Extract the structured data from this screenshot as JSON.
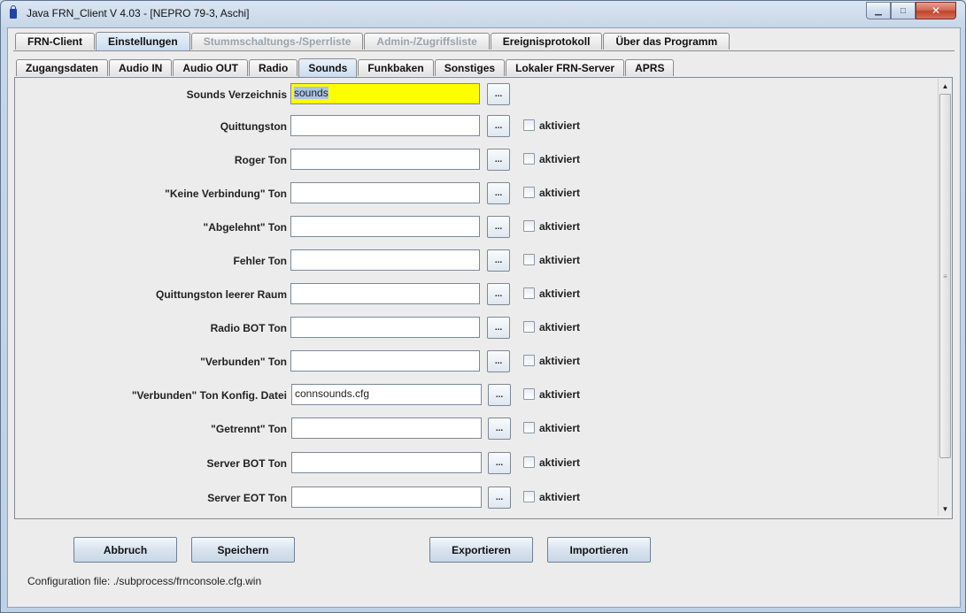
{
  "window": {
    "title": "Java FRN_Client V 4.03 - [NEPRO 79-3, Aschi]"
  },
  "main_tabs": [
    {
      "label": "FRN-Client",
      "state": "normal"
    },
    {
      "label": "Einstellungen",
      "state": "selected"
    },
    {
      "label": "Stummschaltungs-/Sperrliste",
      "state": "disabled"
    },
    {
      "label": "Admin-/Zugriffsliste",
      "state": "disabled"
    },
    {
      "label": "Ereignisprotokoll",
      "state": "normal"
    },
    {
      "label": "Über das Programm",
      "state": "normal"
    }
  ],
  "sub_tabs": [
    {
      "label": "Zugangsdaten",
      "state": "normal"
    },
    {
      "label": "Audio IN",
      "state": "normal"
    },
    {
      "label": "Audio OUT",
      "state": "normal"
    },
    {
      "label": "Radio",
      "state": "normal"
    },
    {
      "label": "Sounds",
      "state": "selected"
    },
    {
      "label": "Funkbaken",
      "state": "normal"
    },
    {
      "label": "Sonstiges",
      "state": "normal"
    },
    {
      "label": "Lokaler FRN-Server",
      "state": "normal"
    },
    {
      "label": "APRS",
      "state": "normal"
    }
  ],
  "browse_label": "...",
  "checkbox_label": "aktiviert",
  "rows": [
    {
      "label": "Sounds Verzeichnis",
      "value": "sounds",
      "checkbox": false,
      "highlight": true
    },
    {
      "label": "Quittungston",
      "value": "",
      "checkbox": true,
      "checked": false
    },
    {
      "label": "Roger Ton",
      "value": "",
      "checkbox": true,
      "checked": false
    },
    {
      "label": "\"Keine Verbindung\" Ton",
      "value": "",
      "checkbox": true,
      "checked": false
    },
    {
      "label": "\"Abgelehnt\" Ton",
      "value": "",
      "checkbox": true,
      "checked": false
    },
    {
      "label": "Fehler Ton",
      "value": "",
      "checkbox": true,
      "checked": false
    },
    {
      "label": "Quittungston leerer Raum",
      "value": "",
      "checkbox": true,
      "checked": false
    },
    {
      "label": "Radio BOT Ton",
      "value": "",
      "checkbox": true,
      "checked": false
    },
    {
      "label": "\"Verbunden\" Ton",
      "value": "",
      "checkbox": true,
      "checked": false
    },
    {
      "label": "\"Verbunden\" Ton Konfig. Datei",
      "value": "connsounds.cfg",
      "checkbox": true,
      "checked": false
    },
    {
      "label": "\"Getrennt\" Ton",
      "value": "",
      "checkbox": true,
      "checked": false
    },
    {
      "label": "Server BOT Ton",
      "value": "",
      "checkbox": true,
      "checked": false
    },
    {
      "label": "Server EOT Ton",
      "value": "",
      "checkbox": true,
      "checked": false
    }
  ],
  "buttons": {
    "abbruch": "Abbruch",
    "speichern": "Speichern",
    "exportieren": "Exportieren",
    "importieren": "Importieren"
  },
  "config_file": "Configuration file: ./subprocess/frnconsole.cfg.win"
}
